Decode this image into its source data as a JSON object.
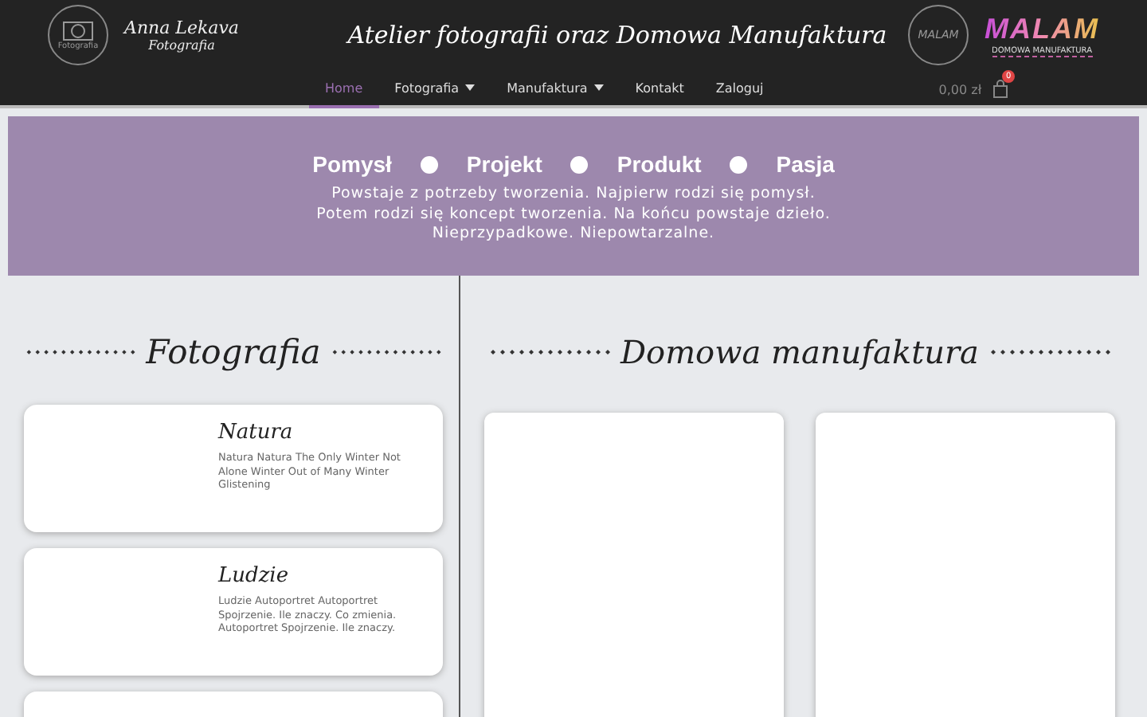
{
  "header": {
    "logo_left": {
      "badge_text": "Fotografia",
      "name": "Anna Lekava",
      "subtitle": "Fotografia"
    },
    "title": "Atelier fotografii oraz Domowa Manufaktura",
    "logo_right": {
      "badge_text": "MALAM",
      "name": "MALAM",
      "subtitle": "DOMOWA MANUFAKTURA"
    }
  },
  "nav": {
    "items": [
      {
        "label": "Home",
        "selected": true,
        "dropdown": false
      },
      {
        "label": "Fotografia",
        "selected": false,
        "dropdown": true
      },
      {
        "label": "Manufaktura",
        "selected": false,
        "dropdown": true
      },
      {
        "label": "Kontakt",
        "selected": false,
        "dropdown": false
      },
      {
        "label": "Zaloguj",
        "selected": false,
        "dropdown": false
      }
    ],
    "cart_total": "0,00 zł",
    "cart_count": "0"
  },
  "banner": {
    "words": [
      "Pomysł",
      "Projekt",
      "Produkt",
      "Pasja"
    ],
    "lines": [
      "Powstaje z potrzeby tworzenia. Najpierw rodzi się pomysł.",
      "Potem rodzi się koncept tworzenia. Na końcu powstaje dzieło.",
      "Nieprzypadkowe. Niepowtarzalne."
    ]
  },
  "left": {
    "heading": "Fotografia",
    "cards": [
      {
        "kind": "category",
        "title": "Natura",
        "text": "Natura Natura The Only Winter Not Alone Winter Out of Many Winter Glistening"
      },
      {
        "kind": "category",
        "title": "Ludzie",
        "text": "Ludzie   Autoportret Autoportret Spojrzenie. Ile znaczy. Co zmienia. Autoportret Spojrzenie. Ile znaczy."
      },
      {
        "kind": "blank"
      }
    ]
  },
  "right": {
    "heading": "Domowa manufaktura",
    "cards": [
      {
        "kind": "blank"
      },
      {
        "kind": "blank"
      }
    ]
  }
}
